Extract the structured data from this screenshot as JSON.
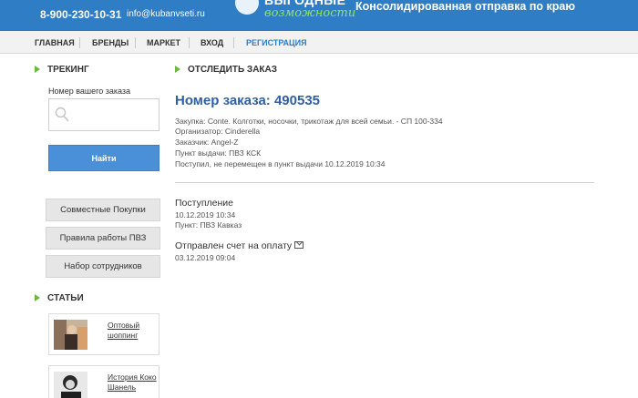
{
  "header": {
    "phone": "8-900-230-10-31",
    "email": "info@kubanvseti.ru",
    "logo_top": "ВЫГОДНЫЕ",
    "logo_bottom": "возможности",
    "tagline": "Консолидированная отправка по краю",
    "bg_color": "#2f7dc4"
  },
  "nav": {
    "items": [
      "ГЛАВНАЯ",
      "БРЕНДЫ",
      "МАРКЕТ",
      "ВХОД",
      "РЕГИСТРАЦИЯ"
    ]
  },
  "sidebar": {
    "tracking_title": "ТРЕКИНГ",
    "order_label": "Номер вашего заказа",
    "search_icon": "search-icon",
    "find_button": "Найти",
    "buttons": [
      "Совместные Покупки",
      "Правила работы ПВЗ",
      "Набор сотрудников"
    ],
    "articles_title": "СТАТЬИ",
    "articles": [
      {
        "title_line1": "Оптовый",
        "title_line2": "шоппинг"
      },
      {
        "title_line1": "История Коко",
        "title_line2": "Шанель"
      }
    ]
  },
  "main": {
    "section_title": "ОТСЛЕДИТЬ ЗАКАЗ",
    "order_number": "Номер заказа: 490535",
    "info": [
      "Закупка: Conte. Колготки, носочки, трикотаж для всей семьи. - СП 100-334",
      "Организатор: Cinderella",
      "Заказчик: Angel-Z",
      "Пункт выдачи: ПВЗ КСК",
      "Поступил, не перемещен в пункт выдачи 10.12.2019 10:34"
    ],
    "events": [
      {
        "title": "Поступление",
        "date": "10.12.2019 10:34",
        "point": "Пункт: ПВЗ Кавказ"
      },
      {
        "title": "Отправлен счет на оплату",
        "date": "03.12.2019 09:04",
        "icon": "mail-icon"
      }
    ]
  }
}
